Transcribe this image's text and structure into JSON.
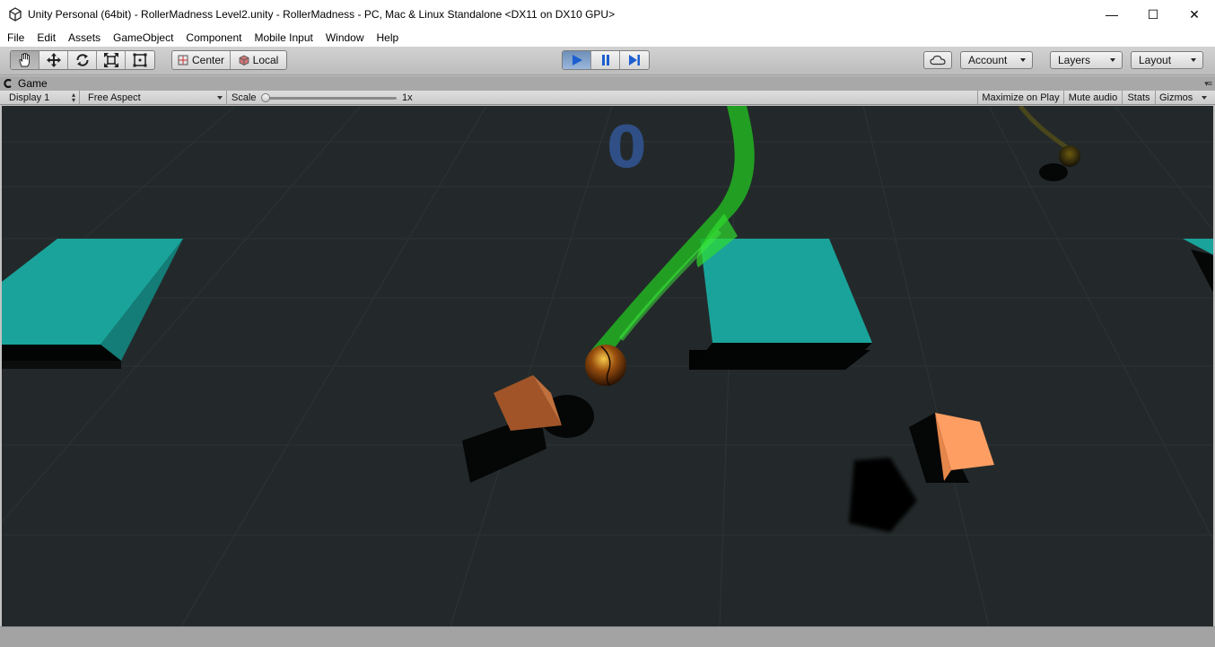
{
  "window": {
    "title": "Unity Personal (64bit) - RollerMadness Level2.unity - RollerMadness - PC, Mac & Linux Standalone <DX11 on DX10 GPU>",
    "controls": {
      "minimize": "—",
      "maximize": "☐",
      "close": "✕"
    }
  },
  "menu": {
    "items": [
      "File",
      "Edit",
      "Assets",
      "GameObject",
      "Component",
      "Mobile Input",
      "Window",
      "Help"
    ]
  },
  "toolbar": {
    "tools": [
      {
        "name": "hand-tool",
        "icon": "hand-icon"
      },
      {
        "name": "move-tool",
        "icon": "move-icon"
      },
      {
        "name": "rotate-tool",
        "icon": "rotate-icon"
      },
      {
        "name": "scale-tool",
        "icon": "scale-icon"
      },
      {
        "name": "rect-tool",
        "icon": "rect-icon"
      }
    ],
    "pivot_label": "Center",
    "space_label": "Local",
    "play_state": "playing",
    "cloud_icon": "cloud-icon",
    "account_label": "Account",
    "layers_label": "Layers",
    "layout_label": "Layout"
  },
  "game_tab": {
    "label": "Game"
  },
  "game_bar": {
    "display_label": "Display 1",
    "aspect_label": "Free Aspect",
    "scale_label": "Scale",
    "scale_value": "1x",
    "maximize_label": "Maximize on Play",
    "mute_label": "Mute audio",
    "stats_label": "Stats",
    "gizmos_label": "Gizmos"
  },
  "game": {
    "score": "0"
  },
  "colors": {
    "play_active": "#6e8fb8",
    "ground": "#23292a",
    "platform": "#1aa39a",
    "trail": "#22c122",
    "score": "#2f4f86",
    "box_dark": "#a05428",
    "box_light": "#ff9e62"
  }
}
